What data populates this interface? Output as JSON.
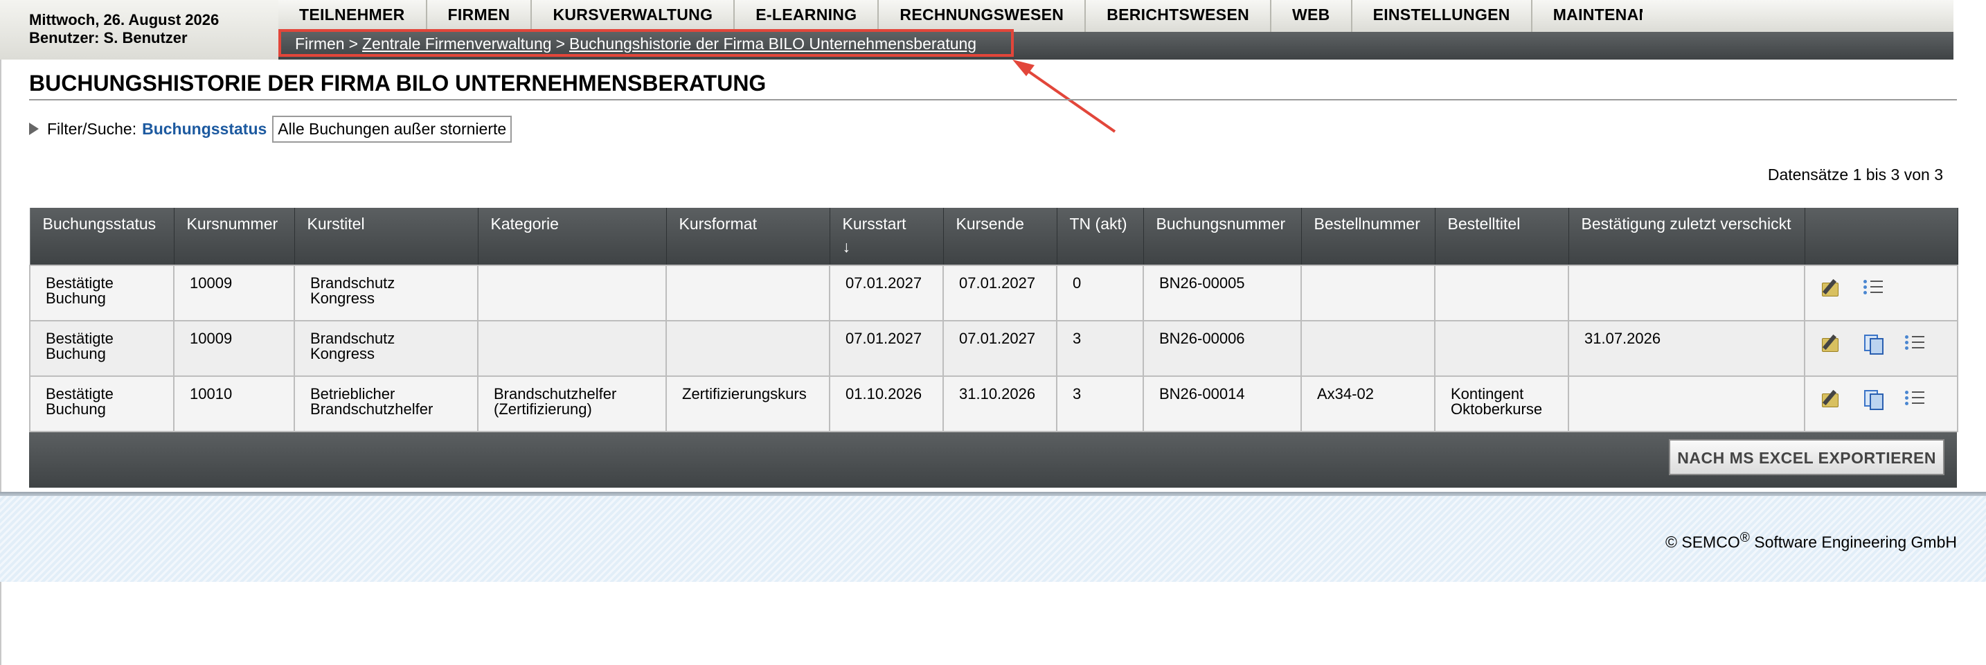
{
  "header": {
    "date": "Mittwoch, 26. August 2026",
    "user": "Benutzer: S. Benutzer"
  },
  "nav": [
    "TEILNEHMER",
    "FIRMEN",
    "KURSVERWALTUNG",
    "E-LEARNING",
    "RECHNUNGSWESEN",
    "BERICHTSWESEN",
    "WEB",
    "EINSTELLUNGEN",
    "MAINTENANCE"
  ],
  "breadcrumb": {
    "item1": "Firmen",
    "sep": ">",
    "item2": "Zentrale Firmenverwaltung",
    "item3": "Buchungshistorie der Firma BILO Unternehmensberatung"
  },
  "page": {
    "title": "BUCHUNGSHISTORIE DER FIRMA BILO UNTERNEHMENSBERATUNG",
    "filter_label": "Filter/Suche:",
    "filter_key": "Buchungsstatus",
    "filter_value": "Alle Buchungen außer stornierte",
    "records": "Datensätze 1 bis 3 von 3"
  },
  "table": {
    "columns": [
      "Buchungsstatus",
      "Kursnummer",
      "Kurstitel",
      "Kategorie",
      "Kursformat",
      "Kursstart",
      "Kursende",
      "TN (akt)",
      "Buchungsnummer",
      "Bestellnummer",
      "Bestelltitel",
      "Bestätigung zuletzt verschickt"
    ],
    "sort_indicator": "↓",
    "rows": [
      {
        "status": "Bestätigte Buchung",
        "kursnummer": "10009",
        "kurstitel": "Brandschutz Kongress",
        "kategorie": "",
        "kursformat": "",
        "start": "07.01.2027",
        "ende": "07.01.2027",
        "tn": "0",
        "buchungsnummer": "BN26-00005",
        "bestellnummer": "",
        "bestelltitel": "",
        "bestaetigung": ""
      },
      {
        "status": "Bestätigte Buchung",
        "kursnummer": "10009",
        "kurstitel": "Brandschutz Kongress",
        "kategorie": "",
        "kursformat": "",
        "start": "07.01.2027",
        "ende": "07.01.2027",
        "tn": "3",
        "buchungsnummer": "BN26-00006",
        "bestellnummer": "",
        "bestelltitel": "",
        "bestaetigung": "31.07.2026"
      },
      {
        "status": "Bestätigte Buchung",
        "kursnummer": "10010",
        "kurstitel": "Betrieblicher Brandschutzhelfer",
        "kategorie": "Brandschutzhelfer (Zertifizierung)",
        "kursformat": "Zertifizierungskurs",
        "start": "01.10.2026",
        "ende": "31.10.2026",
        "tn": "3",
        "buchungsnummer": "BN26-00014",
        "bestellnummer": "Ax34-02",
        "bestelltitel": "Kontingent Oktoberkurse",
        "bestaetigung": ""
      }
    ],
    "export_label": "NACH MS EXCEL EXPORTIEREN"
  },
  "footer": {
    "copyright_prefix": "© SEMCO",
    "copyright_mark": "®",
    "copyright_suffix": " Software Engineering GmbH"
  },
  "icons": {
    "edit": "edit-icon",
    "copy": "copy-documents-icon",
    "details": "list-details-icon",
    "expand": "triangle-right-icon"
  },
  "colors": {
    "accent_link": "#1d5aa0",
    "highlight_box": "#e2463a",
    "table_header": "#4a4e50"
  }
}
